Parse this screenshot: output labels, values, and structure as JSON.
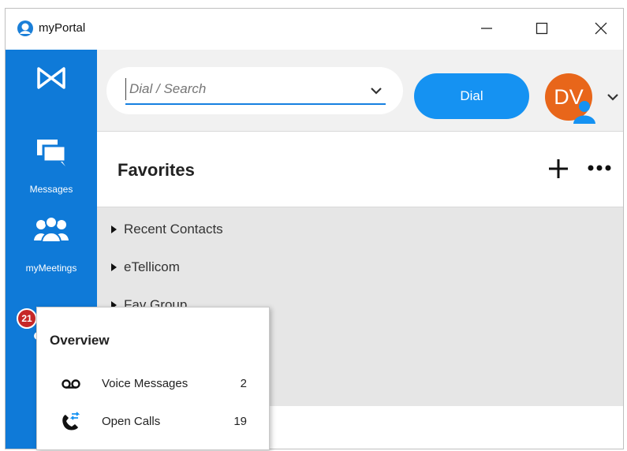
{
  "window": {
    "title": "myPortal",
    "controls": {
      "minimize": "minimize-icon",
      "maximize": "maximize-icon",
      "close": "close-icon"
    }
  },
  "sidebar": {
    "accent": "#0f7ad8",
    "items": [
      {
        "icon": "logo-icon",
        "label": ""
      },
      {
        "icon": "messages-icon",
        "label": "Messages"
      },
      {
        "icon": "meetings-icon",
        "label": "myMeetings"
      },
      {
        "icon": "more-icon",
        "label": ""
      }
    ],
    "badge": "21"
  },
  "topbar": {
    "search": {
      "placeholder": "Dial / Search",
      "value": ""
    },
    "dial_label": "Dial",
    "avatar_initials": "DV",
    "avatar_color": "#e8661a",
    "dial_color": "#1592f2"
  },
  "favorites": {
    "title": "Favorites",
    "groups": [
      {
        "label": "Recent Contacts"
      },
      {
        "label": "eTellicom"
      },
      {
        "label": "Fav Group"
      }
    ]
  },
  "overview_popup": {
    "title": "Overview",
    "rows": [
      {
        "icon": "voicemail-icon",
        "label": "Voice Messages",
        "count": "2"
      },
      {
        "icon": "open-calls-icon",
        "label": "Open Calls",
        "count": "19"
      }
    ]
  }
}
